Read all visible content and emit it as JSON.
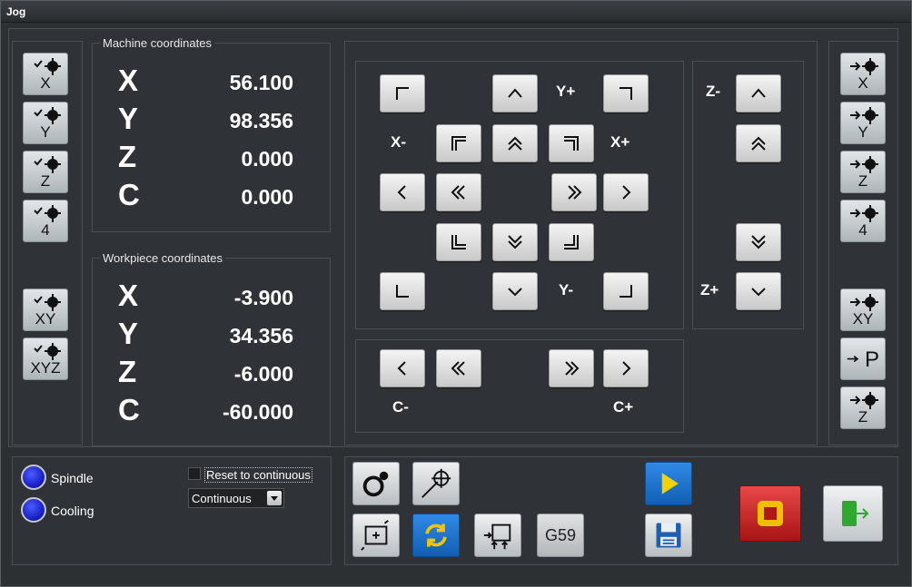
{
  "window": {
    "title": "Jog"
  },
  "machine": {
    "title": "Machine coordinates",
    "rows": [
      {
        "axis": "X",
        "value": "56.100"
      },
      {
        "axis": "Y",
        "value": "98.356"
      },
      {
        "axis": "Z",
        "value": "0.000"
      },
      {
        "axis": "C",
        "value": "0.000"
      }
    ]
  },
  "workpiece": {
    "title": "Workpiece coordinates",
    "rows": [
      {
        "axis": "X",
        "value": "-3.900"
      },
      {
        "axis": "Y",
        "value": "34.356"
      },
      {
        "axis": "Z",
        "value": "-6.000"
      },
      {
        "axis": "C",
        "value": "-60.000"
      }
    ]
  },
  "left_buttons": [
    "X",
    "Y",
    "Z",
    "4",
    "XY",
    "XYZ"
  ],
  "right_buttons": [
    "X",
    "Y",
    "Z",
    "4",
    "XY",
    "P",
    "Z"
  ],
  "jog_labels": {
    "y_plus": "Y+",
    "y_minus": "Y-",
    "x_minus": "X-",
    "x_plus": "X+",
    "z_minus": "Z-",
    "z_plus": "Z+",
    "c_minus": "C-",
    "c_plus": "C+"
  },
  "status": {
    "spindle": "Spindle",
    "cooling": "Cooling",
    "reset_label": "Reset to continuous",
    "mode_value": "Continuous"
  },
  "tools": {
    "g59": "G59"
  },
  "colors": {
    "led": "#2a3cf0",
    "stop": "#c41e1e",
    "exit": "#30b030",
    "play": "#1c78d8"
  }
}
